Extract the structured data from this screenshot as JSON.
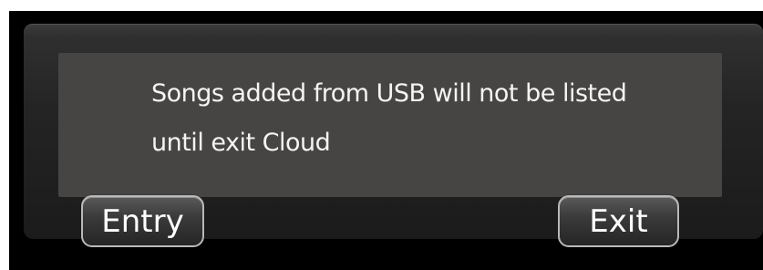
{
  "dialog": {
    "message_line1": "Songs added from USB will not be listed",
    "message_line2": "until exit Cloud"
  },
  "buttons": {
    "entry_label": "Entry",
    "exit_label": "Exit"
  },
  "colors": {
    "background": "#000000",
    "panel": "#474544",
    "text": "#f4f4f4",
    "button_border": "#b9b9b9"
  }
}
